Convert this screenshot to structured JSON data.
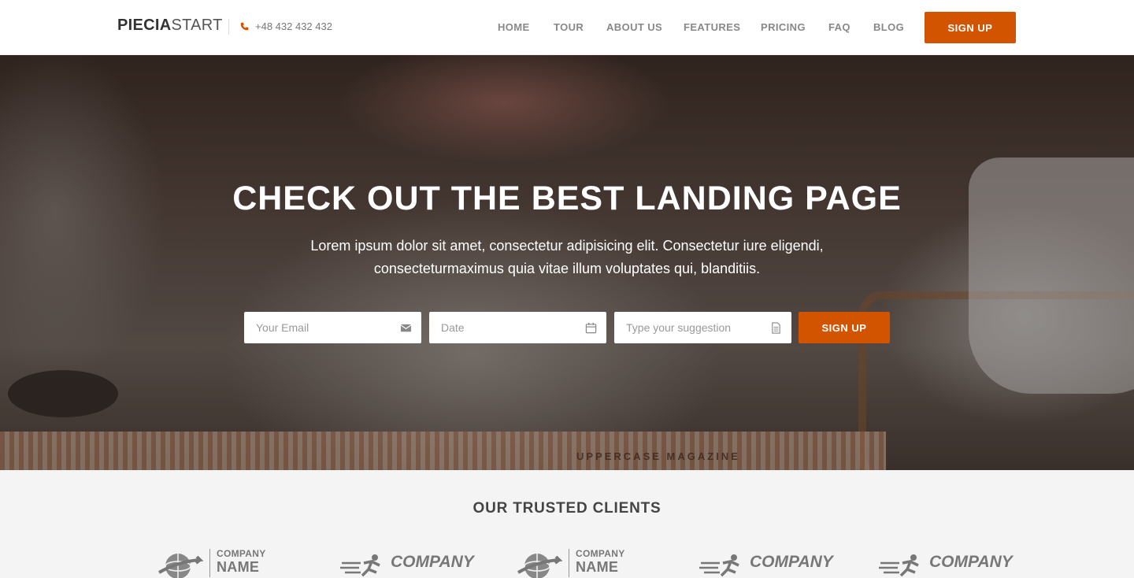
{
  "header": {
    "logo_bold": "PIECIA",
    "logo_light": "START",
    "phone": "+48 432 432 432",
    "nav": [
      "HOME",
      "TOUR",
      "ABOUT US",
      "FEATURES",
      "PRICING",
      "FAQ",
      "BLOG"
    ],
    "signup_label": "SIGN UP"
  },
  "hero": {
    "title": "CHECK OUT THE BEST LANDING PAGE",
    "subtitle": "Lorem ipsum dolor sit amet, consectetur adipisicing elit. Consectetur iure eligendi, consecteturmaximus quia vitae illum voluptates qui, blanditiis.",
    "email_placeholder": "Your Email",
    "date_placeholder": "Date",
    "suggestion_placeholder": "Type your suggestion",
    "signup_label": "SIGN UP",
    "magazine_text": "UPPERCASE MAGAZINE"
  },
  "clients": {
    "title": "OUR TRUSTED CLIENTS",
    "logos": [
      {
        "line1": "COMPANY",
        "line2": "NAME",
        "icon": "globe-arrow-icon"
      },
      {
        "line1": "COMPANY",
        "icon": "runner-icon"
      },
      {
        "line1": "COMPANY",
        "line2": "NAME",
        "icon": "globe-arrow-icon"
      },
      {
        "line1": "COMPANY",
        "icon": "runner-icon"
      },
      {
        "line1": "COMPANY",
        "icon": "runner-icon"
      }
    ]
  },
  "colors": {
    "accent": "#d35400",
    "nav_text": "#888888",
    "clients_bg": "#f4f4f4"
  }
}
